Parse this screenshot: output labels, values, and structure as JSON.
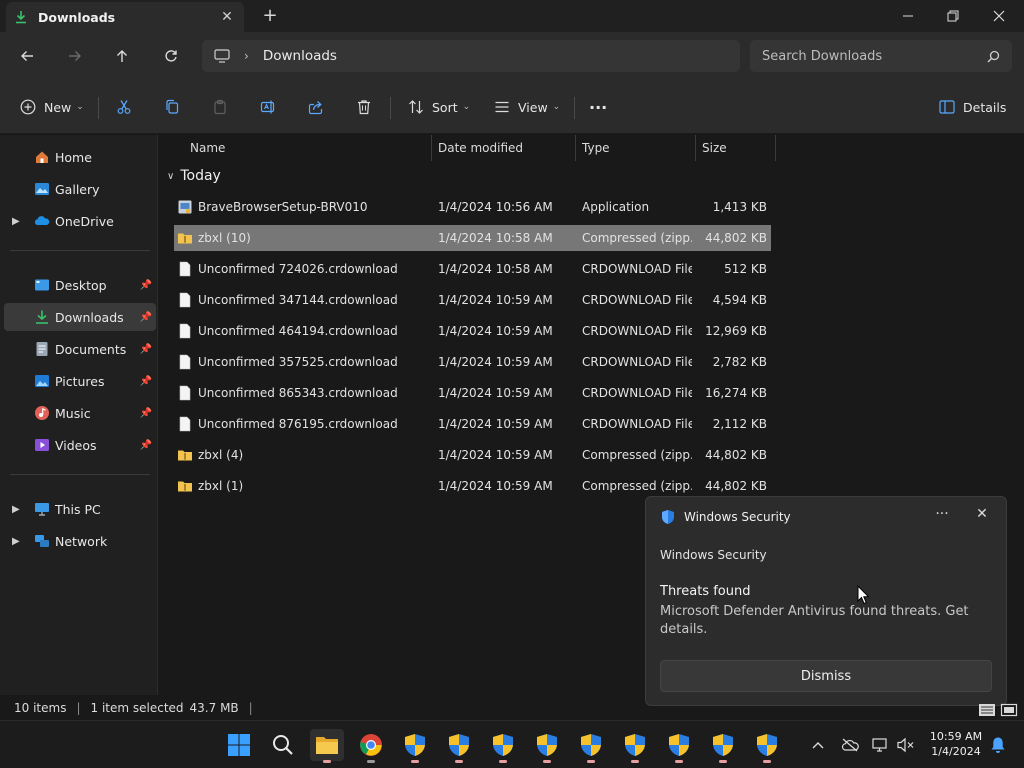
{
  "window": {
    "tab_title": "Downloads",
    "tab_close": "✕",
    "new_tab": "+",
    "minimize": "─",
    "close": "✕"
  },
  "address": {
    "crumb_separator": "›",
    "crumb": "Downloads",
    "search_placeholder": "Search Downloads"
  },
  "toolbar": {
    "new_label": "New",
    "sort_label": "Sort",
    "view_label": "View",
    "more": "···",
    "details_label": "Details"
  },
  "sidebar": {
    "items": [
      {
        "label": "Home"
      },
      {
        "label": "Gallery"
      },
      {
        "label": "OneDrive"
      },
      {
        "label": "Desktop"
      },
      {
        "label": "Downloads"
      },
      {
        "label": "Documents"
      },
      {
        "label": "Pictures"
      },
      {
        "label": "Music"
      },
      {
        "label": "Videos"
      },
      {
        "label": "This PC"
      },
      {
        "label": "Network"
      }
    ]
  },
  "files": {
    "columns": {
      "name": "Name",
      "date": "Date modified",
      "type": "Type",
      "size": "Size"
    },
    "group": "Today",
    "rows": [
      {
        "name": "BraveBrowserSetup-BRV010",
        "date": "1/4/2024 10:56 AM",
        "type": "Application",
        "size": "1,413 KB"
      },
      {
        "name": "zbxl (10)",
        "date": "1/4/2024 10:58 AM",
        "type": "Compressed (zipp...",
        "size": "44,802 KB"
      },
      {
        "name": "Unconfirmed 724026.crdownload",
        "date": "1/4/2024 10:58 AM",
        "type": "CRDOWNLOAD File",
        "size": "512 KB"
      },
      {
        "name": "Unconfirmed 347144.crdownload",
        "date": "1/4/2024 10:59 AM",
        "type": "CRDOWNLOAD File",
        "size": "4,594 KB"
      },
      {
        "name": "Unconfirmed 464194.crdownload",
        "date": "1/4/2024 10:59 AM",
        "type": "CRDOWNLOAD File",
        "size": "12,969 KB"
      },
      {
        "name": "Unconfirmed 357525.crdownload",
        "date": "1/4/2024 10:59 AM",
        "type": "CRDOWNLOAD File",
        "size": "2,782 KB"
      },
      {
        "name": "Unconfirmed 865343.crdownload",
        "date": "1/4/2024 10:59 AM",
        "type": "CRDOWNLOAD File",
        "size": "16,274 KB"
      },
      {
        "name": "Unconfirmed 876195.crdownload",
        "date": "1/4/2024 10:59 AM",
        "type": "CRDOWNLOAD File",
        "size": "2,112 KB"
      },
      {
        "name": "zbxl (4)",
        "date": "1/4/2024 10:59 AM",
        "type": "Compressed (zipp...",
        "size": "44,802 KB"
      },
      {
        "name": "zbxl (1)",
        "date": "1/4/2024 10:59 AM",
        "type": "Compressed (zipp...",
        "size": "44,802 KB"
      }
    ]
  },
  "status": {
    "item_count": "10 items",
    "selection": "1 item selected",
    "selection_size": "43.7 MB"
  },
  "toast": {
    "app_name": "Windows Security",
    "more": "···",
    "close": "✕",
    "source": "Windows Security",
    "title": "Threats found",
    "body": "Microsoft Defender Antivirus found threats. Get details.",
    "dismiss_label": "Dismiss"
  },
  "taskbar": {
    "tray_chevron": "^",
    "time": "10:59 AM",
    "date": "1/4/2024"
  },
  "colors": {
    "accent_download": "#3bbf6a",
    "folder_yellow": "#f3c34f",
    "shield_blue": "#2a7de1",
    "shield_yellow": "#f6c12b",
    "selected_row": "#777777"
  }
}
